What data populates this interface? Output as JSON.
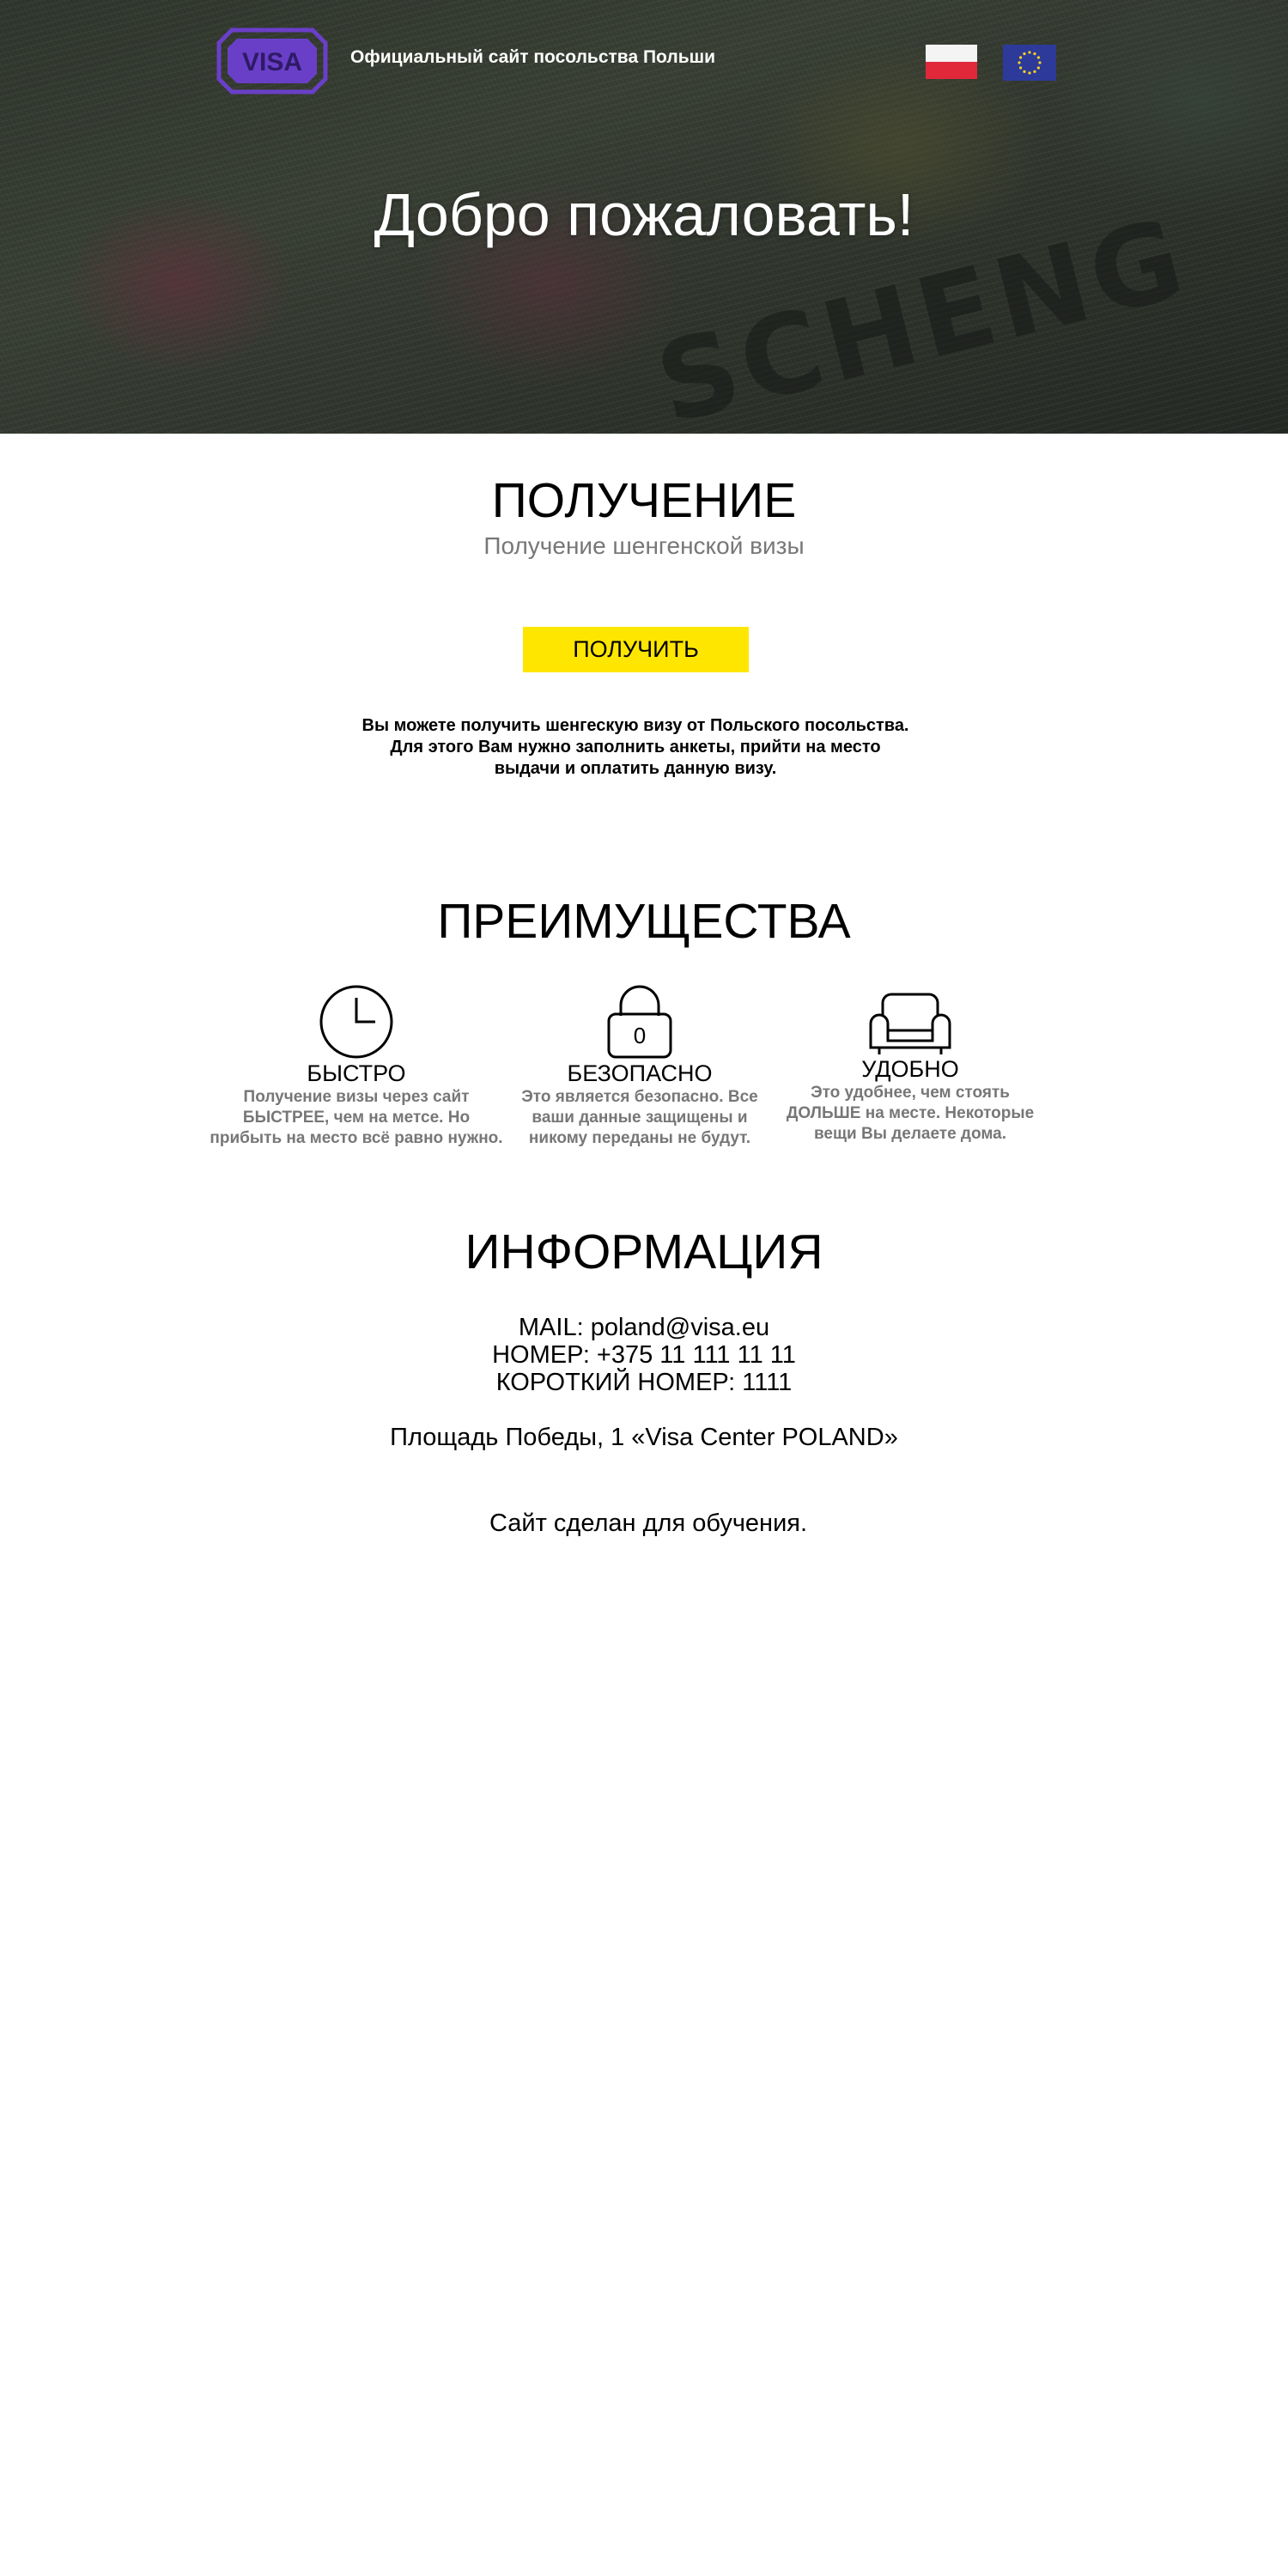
{
  "header": {
    "logo_text": "VISA",
    "site_title": "Официальный сайт посольства Польши",
    "flags": [
      "flag-poland",
      "flag-european-union"
    ]
  },
  "hero": {
    "title": "Добро пожаловать!",
    "background_text": "SCHENG"
  },
  "obtain": {
    "title": "ПОЛУЧЕНИЕ",
    "subtitle": "Получение шенгенской визы",
    "button_label": "ПОЛУЧИТЬ",
    "description_lines": [
      "Вы можете получить шенгескую визу от Польского посольства.",
      "Для этого Вам нужно заполнить анкеты, прийти на место",
      "выдачи и оплатить данную визу."
    ]
  },
  "advantages": {
    "title": "ПРЕИМУЩЕСТВА",
    "items": [
      {
        "icon": "clock-icon",
        "title": "БЫСТРО",
        "lines": [
          "Получение визы через сайт",
          "БЫСТРЕЕ, чем на метсе. Но",
          "прибыть на место всё равно нужно."
        ]
      },
      {
        "icon": "lock-icon",
        "title": "БЕЗОПАСНО",
        "lines": [
          "Это является безопасно. Все",
          "ваши данные защищены и",
          "никому переданы не будут."
        ]
      },
      {
        "icon": "armchair-icon",
        "title": "УДОБНО",
        "lines": [
          "Это удобнее, чем стоять",
          "ДОЛЬШЕ на месте. Некоторые",
          "вещи Вы делаете дома."
        ]
      }
    ]
  },
  "info": {
    "title": "ИНФОРМАЦИЯ",
    "mail": "MAIL: poland@visa.eu",
    "phone": "НОМЕР: +375 11 111 11 11",
    "short_phone": "КОРОТКИЙ НОМЕР: 1111",
    "address": "Площадь Победы, 1 «Visa Center POLAND»",
    "note": "Сайт сделан для обучения."
  },
  "colors": {
    "button": "#ffe600",
    "logo": "#6a3fc8",
    "muted_text": "#777777",
    "flag_red": "#e0283a",
    "flag_eu": "#2d3a9a"
  }
}
